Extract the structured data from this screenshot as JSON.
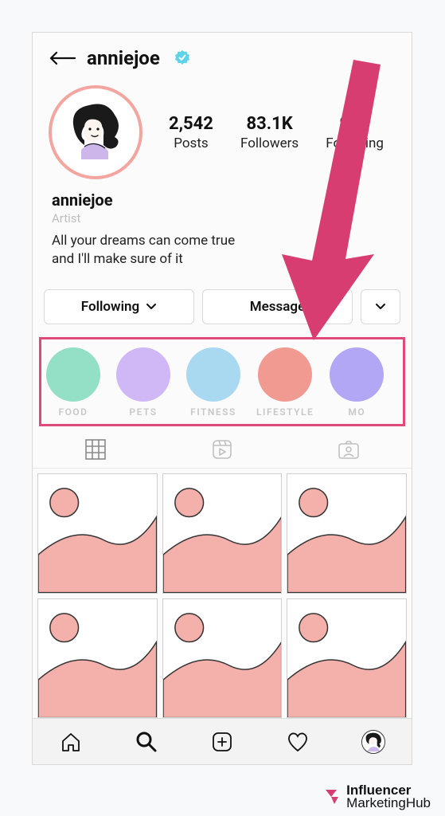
{
  "header": {
    "username": "anniejoe"
  },
  "stats": {
    "posts": {
      "value": "2,542",
      "label": "Posts"
    },
    "followers": {
      "value": "83.1K",
      "label": "Followers"
    },
    "following": {
      "value": "956",
      "label": "Following"
    }
  },
  "bio": {
    "name": "anniejoe",
    "category": "Artist",
    "line1": "All your dreams can come true",
    "line2": "and I'll make sure of it"
  },
  "buttons": {
    "following": "Following",
    "message": "Message"
  },
  "highlights": [
    {
      "label": "FOOD",
      "color": "#93e0c6"
    },
    {
      "label": "PETS",
      "color": "#cfb8f5"
    },
    {
      "label": "FITNESS",
      "color": "#a9d9f0"
    },
    {
      "label": "LIFESTYLE",
      "color": "#f09a92"
    },
    {
      "label": "MO",
      "color": "#b2a7f5"
    }
  ],
  "watermark": {
    "bold": "Influencer",
    "rest": "MarketingHub"
  },
  "colors": {
    "accent_pink": "#e04a7a",
    "avatar_ring": "#f3a6a0"
  }
}
